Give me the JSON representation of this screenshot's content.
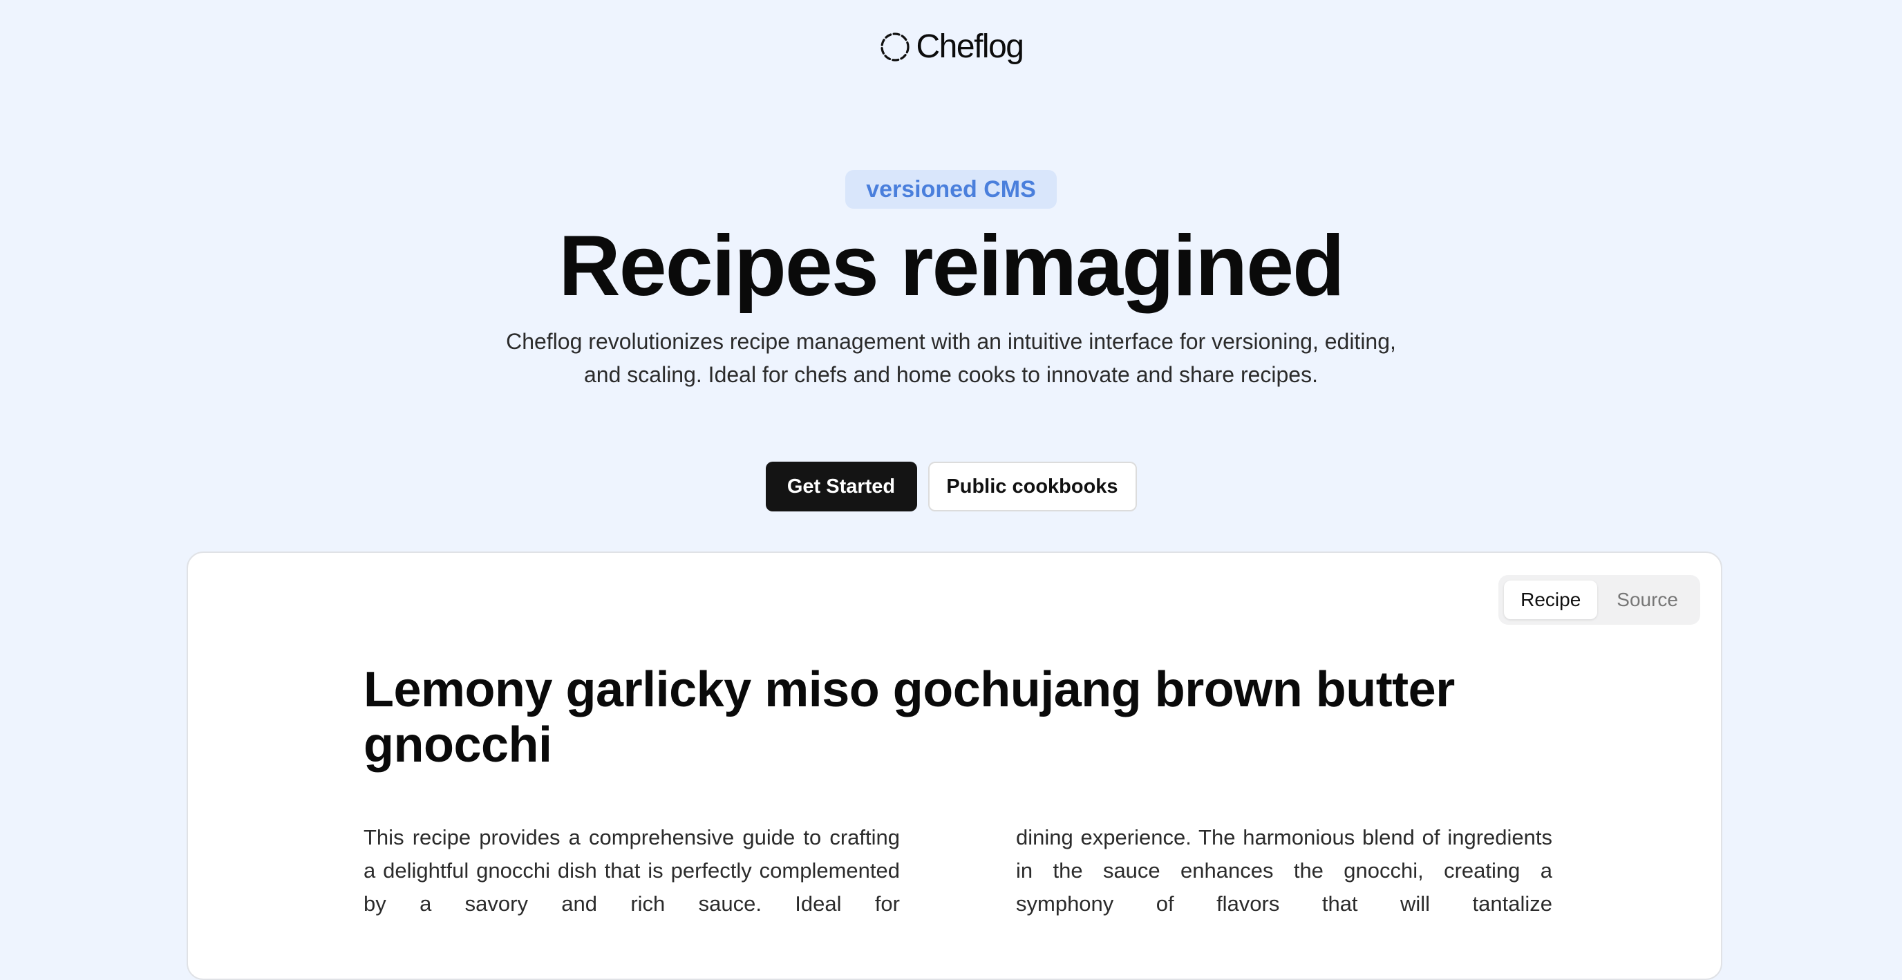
{
  "brand": {
    "name": "Cheflog",
    "logo_icon": "dashed-circle-icon"
  },
  "hero": {
    "badge": "versioned CMS",
    "title": "Recipes reimagined",
    "subtitle": "Cheflog revolutionizes recipe management with an intuitive interface for versioning, editing, and scaling. Ideal for chefs and home cooks to innovate and share recipes.",
    "primary_cta": "Get Started",
    "secondary_cta": "Public cookbooks"
  },
  "preview": {
    "tabs": [
      {
        "label": "Recipe",
        "active": true
      },
      {
        "label": "Source",
        "active": false
      }
    ],
    "recipe_title": "Lemony garlicky miso gochujang brown butter gnocchi",
    "col_left": "This recipe provides a comprehensive guide to crafting a delightful gnocchi dish that is perfectly complemented by a savory and rich sauce. Ideal for",
    "col_right": "dining experience. The harmonious blend of ingredients in the sauce enhances the gnocchi, creating a symphony of flavors that will tantalize"
  },
  "colors": {
    "background": "#eef4fe",
    "badge_bg": "#d9e6fb",
    "badge_text": "#4a7fdc",
    "primary_button": "#141414"
  }
}
